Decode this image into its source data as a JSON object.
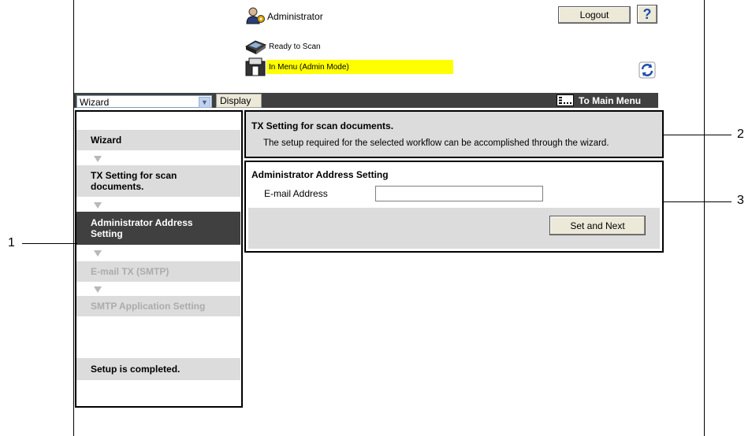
{
  "header": {
    "user_label": "Administrator",
    "logout_label": "Logout",
    "help_label": "?",
    "status_ready": "Ready to Scan",
    "status_mode": "In Menu (Admin Mode)"
  },
  "toolbar": {
    "select_value": "Wizard",
    "display_label": "Display",
    "main_menu_label": "To Main Menu"
  },
  "wizard": {
    "steps": [
      {
        "label": "Wizard"
      },
      {
        "label": "TX Setting for scan documents."
      },
      {
        "label": "Administrator Address Setting"
      },
      {
        "label": "E-mail TX (SMTP)"
      },
      {
        "label": "SMTP Application Setting"
      },
      {
        "label": "Setup is completed."
      }
    ]
  },
  "info": {
    "title": "TX Setting for scan documents.",
    "description": "The setup required for the selected workflow can be accomplished through the wizard."
  },
  "form": {
    "title": "Administrator Address Setting",
    "email_label": "E-mail Address",
    "email_value": "",
    "submit_label": "Set and Next"
  },
  "callouts": {
    "one": "1",
    "two": "2",
    "three": "3"
  },
  "colors": {
    "highlight": "#ffff00",
    "toolbar": "#404040",
    "active_step": "#404040",
    "inactive_step": "#dcdcdc",
    "disabled_text": "#ababab"
  },
  "icons": {
    "user": "admin-user-icon",
    "help": "help-icon",
    "scanner_ready": "scanner-icon",
    "scanner_menu": "scanner-menu-icon",
    "refresh": "refresh-icon",
    "main_menu": "main-menu-icon"
  }
}
